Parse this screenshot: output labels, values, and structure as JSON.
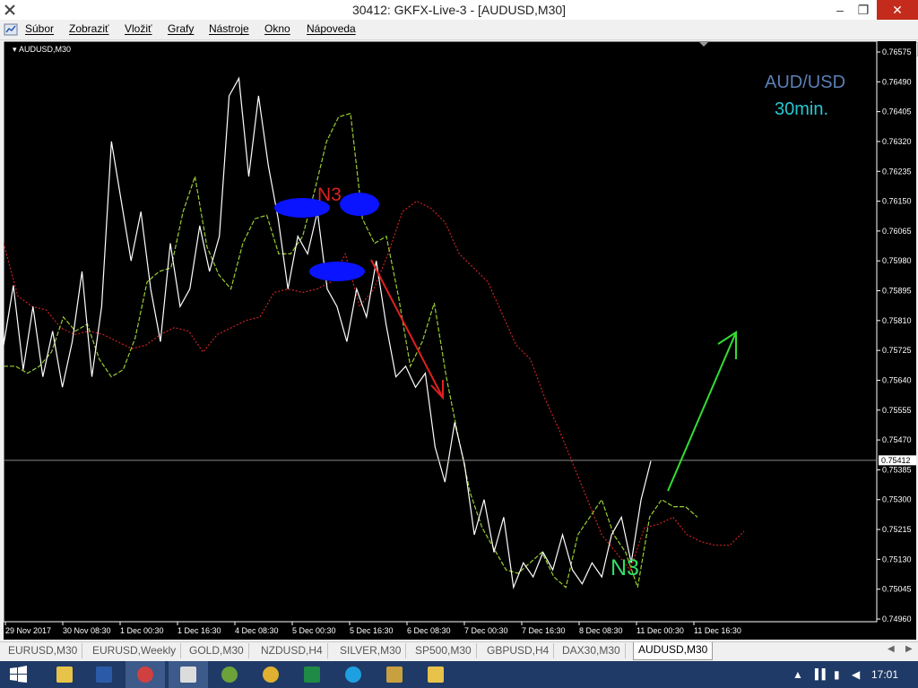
{
  "window": {
    "title": "30412: GKFX-Live-3 - [AUDUSD,M30]"
  },
  "menu": {
    "items": [
      "Súbor",
      "Zobraziť",
      "Vložiť",
      "Grafy",
      "Nástroje",
      "Okno",
      "Nápoveda"
    ]
  },
  "chart": {
    "symbol_label": "AUDUSD,M30",
    "pair_annotation": "AUD/USD",
    "timeframe_annotation": "30min.",
    "marker_top": "N3",
    "marker_bottom": "N3",
    "current_price_label": "0.75412",
    "colors": {
      "background": "#000000",
      "price_line": "#ffffff",
      "chikou_line": "#9acd32",
      "kijun_line": "#cc2222",
      "highlight": "#0a14ff",
      "down_arrow": "#e02020",
      "up_arrow": "#33dd33",
      "pair_text": "#5b7fb5",
      "timeframe_text": "#27c7d0",
      "marker_top_text": "#dd2222",
      "marker_bottom_text": "#33dd66"
    }
  },
  "chart_data": {
    "type": "line",
    "title": "AUDUSD,M30",
    "y_ticks": [
      "0.76575",
      "0.76490",
      "0.76405",
      "0.76320",
      "0.76235",
      "0.76150",
      "0.76065",
      "0.75980",
      "0.75895",
      "0.75810",
      "0.75725",
      "0.75640",
      "0.75555",
      "0.75470",
      "0.75385",
      "0.75300",
      "0.75215",
      "0.75130",
      "0.75045",
      "0.74960"
    ],
    "ylim": [
      0.7496,
      0.76575
    ],
    "x_ticks": [
      "29 Nov 2017",
      "30 Nov 08:30",
      "1 Dec 00:30",
      "1 Dec 16:30",
      "4 Dec 08:30",
      "5 Dec 00:30",
      "5 Dec 16:30",
      "6 Dec 08:30",
      "7 Dec 00:30",
      "7 Dec 16:30",
      "8 Dec 08:30",
      "11 Dec 00:30",
      "11 Dec 16:30"
    ],
    "current_price": 0.75412,
    "series": [
      {
        "values": [
          0.7574,
          0.7591,
          0.7567,
          0.7585,
          0.7565,
          0.7578,
          0.7562,
          0.7575,
          0.7595,
          0.7565,
          0.7585,
          0.7632,
          0.7615,
          0.7598,
          0.7612,
          0.759,
          0.7575,
          0.7603,
          0.7585,
          0.759,
          0.7608,
          0.7595,
          0.7605,
          0.7645,
          0.765,
          0.7622,
          0.7645,
          0.7625,
          0.761,
          0.759,
          0.7605,
          0.76,
          0.7612,
          0.759,
          0.7585,
          0.7575,
          0.759,
          0.7582,
          0.7598,
          0.758,
          0.7565,
          0.7568,
          0.7562,
          0.7566,
          0.7545,
          0.7535,
          0.7552,
          0.754,
          0.752,
          0.753,
          0.7515,
          0.7525,
          0.7505,
          0.7512,
          0.7508,
          0.7515,
          0.751,
          0.752,
          0.751,
          0.7506,
          0.7512,
          0.7508,
          0.752,
          0.7525,
          0.7512,
          0.753,
          0.7541
        ]
      },
      {
        "values": [
          0.7568,
          0.7568,
          0.7566,
          0.7568,
          0.7572,
          0.7582,
          0.7578,
          0.758,
          0.757,
          0.7565,
          0.7567,
          0.7576,
          0.7592,
          0.7595,
          0.7596,
          0.7612,
          0.7622,
          0.7602,
          0.7594,
          0.759,
          0.7603,
          0.761,
          0.7611,
          0.76,
          0.76,
          0.7605,
          0.7618,
          0.7632,
          0.7639,
          0.764,
          0.761,
          0.7603,
          0.7605,
          0.7588,
          0.7568,
          0.7575,
          0.7586,
          0.7565,
          0.7548,
          0.7532,
          0.7522,
          0.7516,
          0.751,
          0.7509,
          0.7512,
          0.7515,
          0.7508,
          0.7505,
          0.752,
          0.7525,
          0.753,
          0.752,
          0.7515,
          0.7505,
          0.7525,
          0.753,
          0.7528,
          0.7528,
          0.7525
        ]
      },
      {
        "values": [
          0.7603,
          0.7588,
          0.7585,
          0.7584,
          0.7579,
          0.7577,
          0.7578,
          0.7577,
          0.7575,
          0.7573,
          0.7574,
          0.7577,
          0.7579,
          0.7578,
          0.7572,
          0.7577,
          0.7579,
          0.7581,
          0.7582,
          0.7589,
          0.759,
          0.7589,
          0.759,
          0.7592,
          0.76,
          0.7585,
          0.759,
          0.76,
          0.7612,
          0.7615,
          0.7613,
          0.7609,
          0.76,
          0.7596,
          0.7592,
          0.7583,
          0.7574,
          0.757,
          0.7559,
          0.755,
          0.754,
          0.753,
          0.752,
          0.7515,
          0.751,
          0.7522,
          0.7523,
          0.7525,
          0.752,
          0.7518,
          0.7517,
          0.7517,
          0.7521
        ]
      }
    ]
  },
  "tabs": [
    "EURUSD,M30",
    "EURUSD,Weekly",
    "GOLD,M30",
    "NZDUSD,H4",
    "SILVER,M30",
    "SP500,M30",
    "GBPUSD,H4",
    "DAX30,M30",
    "AUDUSD,M30"
  ],
  "taskbar": {
    "clock": "17:01",
    "apps": [
      "explorer-icon",
      "word-icon",
      "meta-icon",
      "metatrader-icon",
      "gkfx-icon",
      "chrome-icon",
      "excel-icon",
      "skype-icon",
      "photo-icon",
      "folder-icon"
    ]
  }
}
